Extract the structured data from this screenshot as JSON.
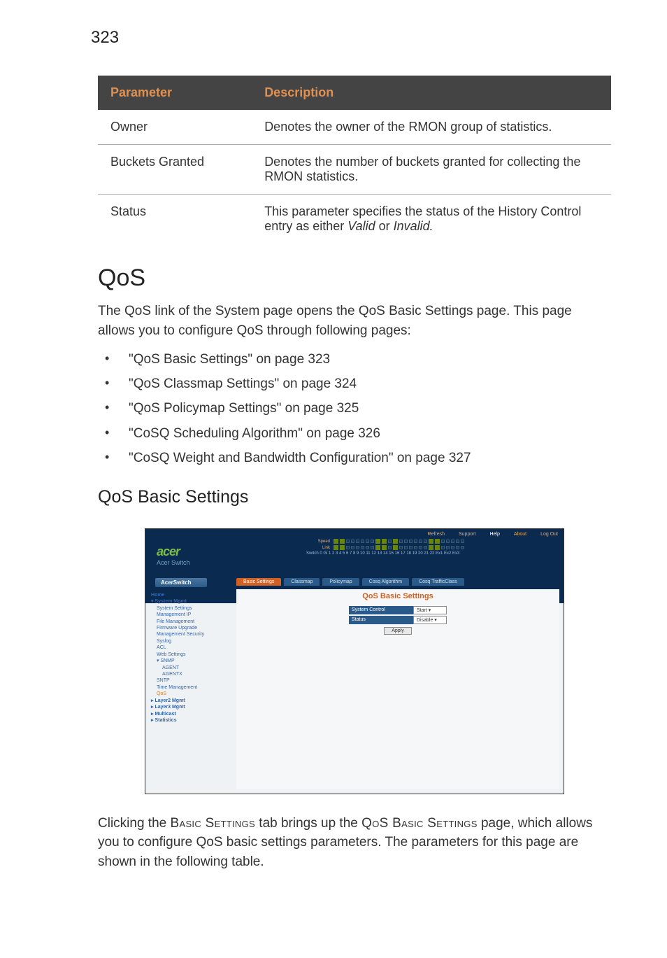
{
  "page_number": "323",
  "param_table": {
    "headers": {
      "param": "Parameter",
      "desc": "Description"
    },
    "rows": [
      {
        "param": "Owner",
        "desc": "Denotes the owner of the RMON group of statistics."
      },
      {
        "param": "Buckets Granted",
        "desc": "Denotes the number of buckets granted for collecting the RMON statistics."
      },
      {
        "param": "Status",
        "desc_pre": "This parameter specifies the status of the History Control entry as either ",
        "desc_i1": "Valid",
        "desc_mid": " or ",
        "desc_i2": "Invalid.",
        "desc_post": ""
      }
    ]
  },
  "h1": "QoS",
  "intro": "The QoS link of the System page opens the QoS Basic Settings page. This page allows you to configure QoS through following pages:",
  "bullets": [
    " \"QoS Basic Settings\" on page 323",
    " \"QoS Classmap Settings\" on page 324",
    " \"QoS Policymap Settings\" on page 325",
    " \"CoSQ Scheduling Algorithm\" on page 326",
    "\"CoSQ Weight and Bandwidth Configuration\" on page 327"
  ],
  "h2": "QoS Basic Settings",
  "screenshot": {
    "top_links": {
      "refresh": "Refresh",
      "support": "Support",
      "help": "Help",
      "about": "About",
      "logout": "Log Out"
    },
    "logo": "acer",
    "logo_sub": "Acer Switch",
    "port_labels": {
      "speed": "Speed",
      "link": "Link",
      "switch": "Switch 0 Gi 1 2 3 4 5 6 7 8 9 10 11 12 13 14 15 16 17 18 19 20 21 22 Ex1 Ex2 Ex3"
    },
    "breadcrumb": "AcerSwitch",
    "tabs": [
      "Basic Settings",
      "Classmap",
      "Policymap",
      "Cosq Algorithm",
      "Cosq TrafficClass"
    ],
    "sidebar": [
      {
        "text": "Home",
        "cls": "hd"
      },
      {
        "text": "▾ System Mgmt",
        "cls": "hd"
      },
      {
        "text": "System Settings",
        "cls": "ind"
      },
      {
        "text": "Management IP",
        "cls": "ind"
      },
      {
        "text": "File Management",
        "cls": "ind"
      },
      {
        "text": "Firmware Upgrade",
        "cls": "ind"
      },
      {
        "text": "Management Security",
        "cls": "ind"
      },
      {
        "text": "Syslog",
        "cls": "ind"
      },
      {
        "text": "ACL",
        "cls": "ind"
      },
      {
        "text": "Web Settings",
        "cls": "ind"
      },
      {
        "text": "▾ SNMP",
        "cls": "ind"
      },
      {
        "text": "AGENT",
        "cls": "ind2"
      },
      {
        "text": "AGENTX",
        "cls": "ind2"
      },
      {
        "text": "SNTP",
        "cls": "ind"
      },
      {
        "text": "Time Management",
        "cls": "ind"
      },
      {
        "text": "QoS",
        "cls": "ind orange-link"
      },
      {
        "text": "▸ Layer2 Mgmt",
        "cls": "hd"
      },
      {
        "text": "▸ Layer3 Mgmt",
        "cls": "hd"
      },
      {
        "text": "▸ Multicast",
        "cls": "hd"
      },
      {
        "text": "▸ Statistics",
        "cls": "hd"
      }
    ],
    "main_title": "QoS Basic Settings",
    "form": {
      "system_control_label": "System Control",
      "system_control_value": "Start",
      "status_label": "Status",
      "status_value": "Disable",
      "button": "Apply"
    }
  },
  "closing": {
    "t1": "Clicking the ",
    "sc1": "Basic Settings",
    "t2": " tab brings up the ",
    "sc2": "QoS Basic Settings",
    "t3": " page, which allows you to configure QoS basic settings parameters. The parameters for this page are shown in the following table."
  }
}
